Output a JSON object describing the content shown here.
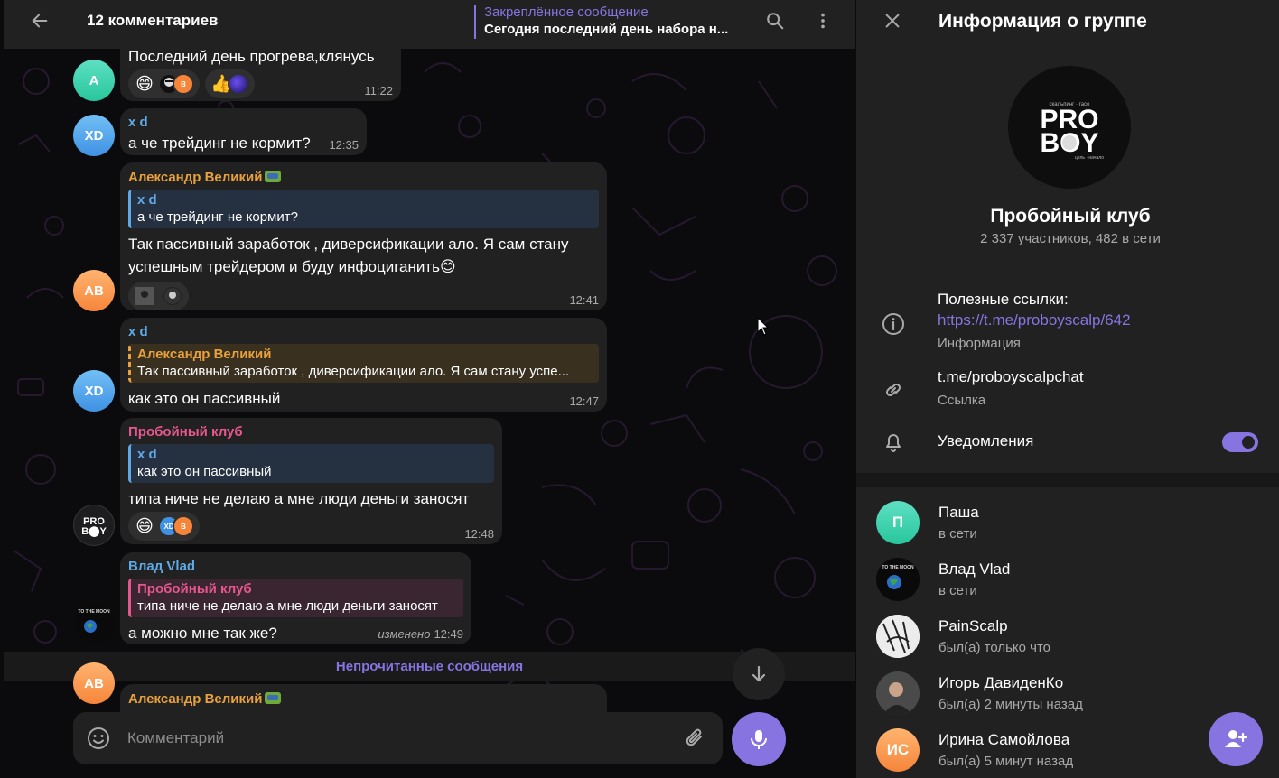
{
  "header": {
    "title": "12 комментариев",
    "pinned_label": "Закреплённое сообщение",
    "pinned_text": "Сегодня последний день набора н..."
  },
  "messages": [
    {
      "avatar": "A",
      "text": "Последний день прогрева,клянусь",
      "time": "11:22",
      "reactions": [
        "grinning-face",
        "users-avatars",
        "thumbs-up",
        "neon-ball"
      ]
    },
    {
      "avatar": "XD",
      "sender": "x d",
      "text": "а че трейдинг не кормит?",
      "time": "12:35"
    },
    {
      "avatar": "AB",
      "sender": "Александр Великий",
      "reply_name": "x d",
      "reply_text": "а че трейдинг не кормит?",
      "text_line1": "Так пассивный заработок , диверсификации ало. Я сам стану",
      "text_line2": "успешным трейдером и буду инфоциганить😊",
      "time": "12:41"
    },
    {
      "avatar": "XD",
      "sender": "x d",
      "reply_name": "Александр Великий",
      "reply_text": "Так пассивный заработок , диверсификации ало. Я сам стану успе...",
      "text": "как это он пассивный",
      "time": "12:47"
    },
    {
      "sender": "Пробойный клуб",
      "reply_name": "x d",
      "reply_text": "как это он пассивный",
      "text": "типа ниче не делаю а мне люди деньги заносят",
      "time": "12:48",
      "reaction_avatars": [
        "XD",
        "B"
      ]
    },
    {
      "sender": "Влад Vlad",
      "reply_name": "Пробойный клуб",
      "reply_text": "типа ниче не делаю а мне люди деньги заносят",
      "text": "а можно мне так же?",
      "edited": "изменено",
      "time": "12:49"
    },
    {
      "avatar": "AB",
      "sender": "Александр Великий"
    }
  ],
  "reaction_avatar_letters": [
    "B",
    "XD"
  ],
  "unread_label": "Непрочитанные сообщения",
  "composer": {
    "placeholder": "Комментарий"
  },
  "info": {
    "title": "Информация о группе",
    "group_name": "Пробойный клуб",
    "members_summary": "2 337 участников, 482 в сети",
    "avatar_logo_top": "PRO",
    "avatar_logo_bottom": "BOY",
    "avatar_logo_small_top": "скальпинг · гасе",
    "avatar_logo_small_bottom": "цель · начало",
    "links_title": "Полезные ссылки:",
    "links_url": "https://t.me/proboyscalp/642",
    "links_sub": "Информация",
    "chat_link": "t.me/proboyscalpchat",
    "chat_link_sub": "Ссылка",
    "notifications": "Уведомления",
    "notifications_on": true
  },
  "members": [
    {
      "initials": "П",
      "name": "Паша",
      "status": "в сети",
      "color": "#28c69d"
    },
    {
      "initials": "",
      "name": "Влад Vlad",
      "status": "в сети",
      "color": "#111111"
    },
    {
      "initials": "",
      "name": "PainScalp",
      "status": "был(а) только что",
      "color": "#e8e8e8"
    },
    {
      "initials": "",
      "name": "Игорь ДавиденКо",
      "status": "был(а) 2 минуты назад",
      "color": "#3a3a3a"
    },
    {
      "initials": "ИС",
      "name": "Ирина Самойлова",
      "status": "был(а) 5 минут назад",
      "color": "#f6853a"
    }
  ],
  "colors": {
    "accent": "#8774e1",
    "bubble": "#212121",
    "sender_blue": "#5ea9e6",
    "sender_orange": "#e8a13c",
    "sender_pink": "#e6588d"
  }
}
